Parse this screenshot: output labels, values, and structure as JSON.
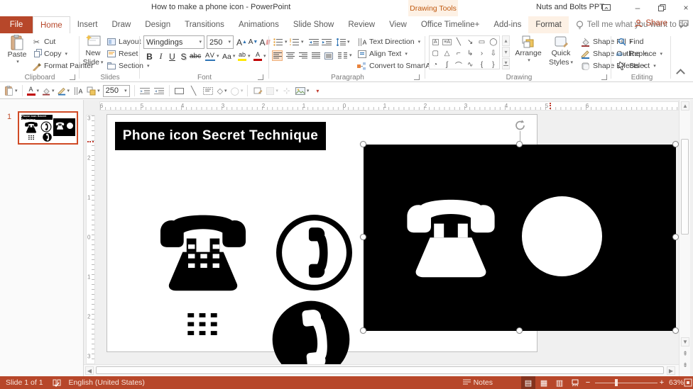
{
  "window": {
    "title": "How to make a phone icon - PowerPoint",
    "contextual_tools": "Drawing Tools",
    "account": "Nuts and Bolts PPT"
  },
  "tabs": {
    "file": "File",
    "main": [
      "Home",
      "Insert",
      "Draw",
      "Design",
      "Transitions",
      "Animations",
      "Slide Show",
      "Review",
      "View",
      "Office Timeline+",
      "Add-ins"
    ],
    "contextual": "Format",
    "tell_me": "Tell me what you want to do",
    "share": "Share"
  },
  "ribbon": {
    "clipboard": {
      "group": "Clipboard",
      "paste": "Paste",
      "cut": "Cut",
      "copy": "Copy",
      "format_painter": "Format Painter"
    },
    "slides": {
      "group": "Slides",
      "new_line1": "New",
      "new_line2": "Slide",
      "layout": "Layout",
      "reset": "Reset",
      "section": "Section"
    },
    "font": {
      "group": "Font",
      "name": "Wingdings",
      "size": "250",
      "bold": "B",
      "italic": "I",
      "underline": "U",
      "shadow": "S",
      "strikethrough": "abc",
      "spacing": "AV",
      "case": "Aa",
      "highlight": "ab",
      "color": "A",
      "grow": "A",
      "shrink": "A",
      "clear": "A"
    },
    "paragraph": {
      "group": "Paragraph",
      "text_direction": "Text Direction",
      "align_text": "Align Text",
      "convert": "Convert to SmartArt"
    },
    "drawing": {
      "group": "Drawing",
      "arrange": "Arrange",
      "quick_line1": "Quick",
      "quick_line2": "Styles",
      "fill": "Shape Fill",
      "outline": "Shape Outline",
      "effects": "Shape Effects"
    },
    "editing": {
      "group": "Editing",
      "find": "Find",
      "replace": "Replace",
      "select": "Select"
    }
  },
  "qat": {
    "font_size": "250"
  },
  "slides_panel": {
    "number": "1"
  },
  "slide": {
    "title": "Phone icon Secret Technique"
  },
  "rulers": {
    "horizontal": [
      "6",
      "5",
      "4",
      "3",
      "2",
      "1",
      "0",
      "1",
      "2",
      "3",
      "4",
      "5",
      "6"
    ],
    "vertical": [
      "3",
      "2",
      "1",
      "0",
      "1",
      "2",
      "3"
    ]
  },
  "status": {
    "slide": "Slide 1 of 1",
    "language": "English (United States)",
    "notes": "Notes",
    "zoom": "63%"
  },
  "colors": {
    "accent": "#B7472A",
    "contextual": "#C55A11",
    "selection_border": "#D04A25"
  }
}
